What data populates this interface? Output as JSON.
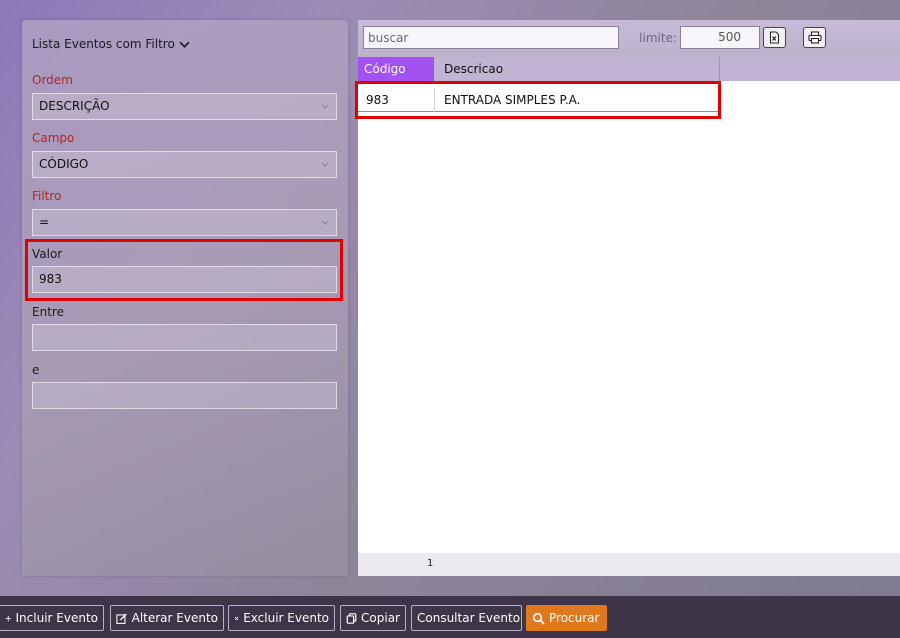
{
  "filter_panel": {
    "title": "Lista Eventos com Filtro",
    "ordem_label": "Ordem",
    "ordem_value": "DESCRIÇÃO",
    "campo_label": "Campo",
    "campo_value": "CÓDIGO",
    "filtro_label": "Filtro",
    "filtro_value": "=",
    "valor_label": "Valor",
    "valor_value": "983",
    "entre_label": "Entre",
    "entre_value": "",
    "e_label": "e",
    "e_value": ""
  },
  "grid": {
    "search_placeholder": "buscar",
    "limit_label": "limite:",
    "limit_value": "500",
    "columns": [
      "Código",
      "Descricao"
    ],
    "rows": [
      {
        "codigo": "983",
        "descricao": "ENTRADA SIMPLES P.A."
      }
    ],
    "page": "1"
  },
  "actions": {
    "incluir": "Incluir Evento",
    "alterar": "Alterar Evento",
    "excluir": "Excluir Evento",
    "copiar": "Copiar",
    "consultar": "Consultar Evento",
    "procurar": "Procurar"
  },
  "icons": {
    "title_chevron": "chevron-down-icon",
    "select_arrow": "chevron-down-icon",
    "export": "excel-export-icon",
    "print": "printer-icon",
    "incluir": "plus-icon",
    "alterar": "edit-icon",
    "excluir": "close-icon",
    "copiar": "copy-icon",
    "procurar": "search-icon"
  },
  "colors": {
    "label_red": "#b4261e",
    "header_accent": "#a352f2",
    "highlight": "#e00000",
    "primary_button": "#e0781e",
    "bottom_bar": "#3f3548"
  }
}
